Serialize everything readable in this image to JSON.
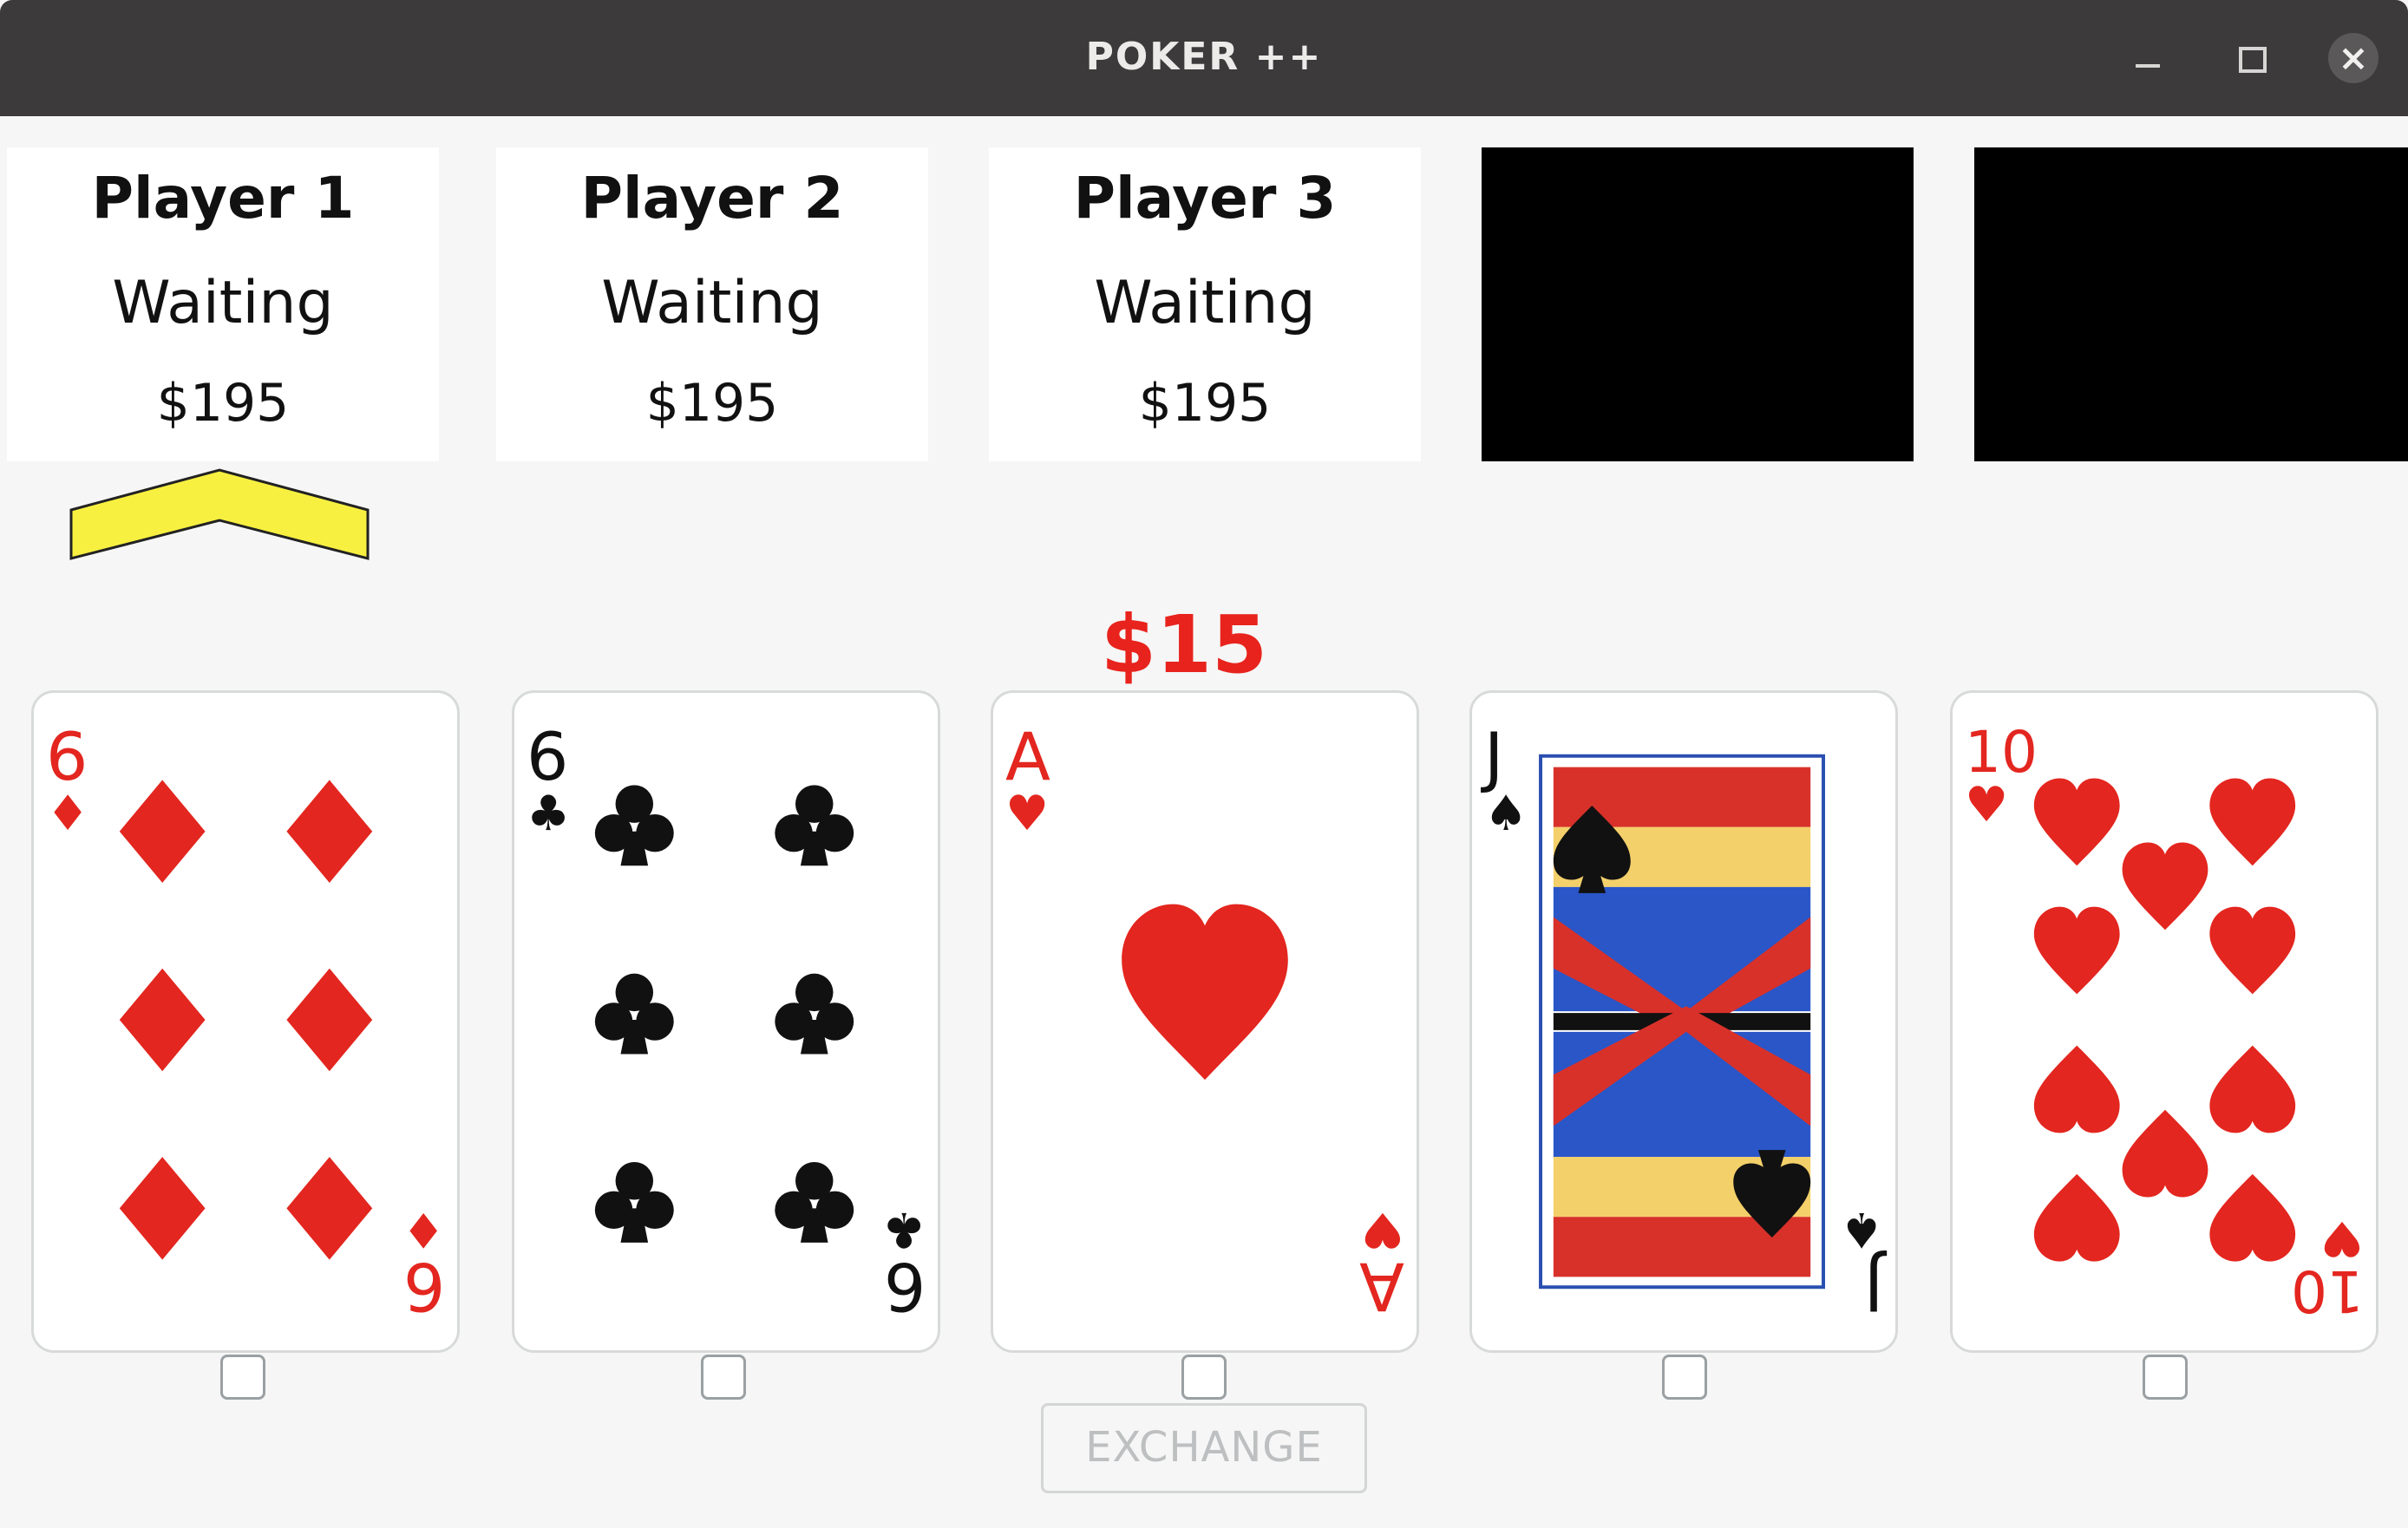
{
  "window": {
    "title": "POKER ++"
  },
  "players": [
    {
      "name": "Player 1",
      "status": "Waiting",
      "money": "$195"
    },
    {
      "name": "Player 2",
      "status": "Waiting",
      "money": "$195"
    },
    {
      "name": "Player 3",
      "status": "Waiting",
      "money": "$195"
    }
  ],
  "pot": "$15",
  "cards": [
    {
      "rank": "6",
      "suit": "diamonds",
      "suit_symbol": "♦",
      "color": "#e3261f"
    },
    {
      "rank": "6",
      "suit": "clubs",
      "suit_symbol": "♣",
      "color": "#111111"
    },
    {
      "rank": "A",
      "suit": "hearts",
      "suit_symbol": "♥",
      "color": "#e3261f"
    },
    {
      "rank": "J",
      "suit": "spades",
      "suit_symbol": "♠",
      "color": "#111111"
    },
    {
      "rank": "10",
      "suit": "hearts",
      "suit_symbol": "♥",
      "color": "#e3261f"
    }
  ],
  "exchange_label": "EXCHANGE",
  "turn_indicator_color": "#f7f041"
}
